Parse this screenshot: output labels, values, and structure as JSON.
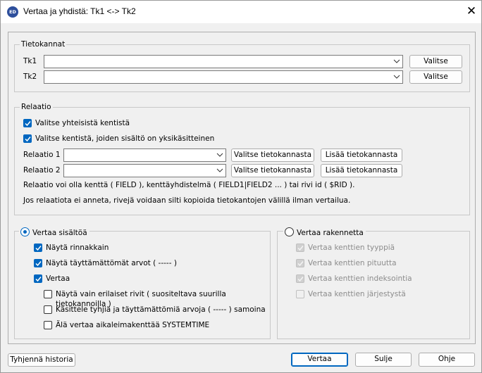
{
  "window": {
    "title": "Vertaa ja yhdistä:  Tk1 <-> Tk2",
    "app_icon": "ED"
  },
  "tietokannat": {
    "legend": "Tietokannat",
    "rows": [
      {
        "label": "Tk1",
        "value": "",
        "button": "Valitse"
      },
      {
        "label": "Tk2",
        "value": "",
        "button": "Valitse"
      }
    ]
  },
  "relaatio": {
    "legend": "Relaatio",
    "check_common": {
      "label": "Valitse yhteisistä kentistä",
      "checked": true
    },
    "check_unique": {
      "label": "Valitse kentistä, joiden sisältö on yksikäsitteinen",
      "checked": true
    },
    "rows": [
      {
        "label": "Relaatio 1",
        "value": "",
        "select_button": "Valitse tietokannasta",
        "add_button": "Lisää tietokannasta"
      },
      {
        "label": "Relaatio 2",
        "value": "",
        "select_button": "Valitse tietokannasta",
        "add_button": "Lisää tietokannasta"
      }
    ],
    "info1": "Relaatio voi olla kenttä ( FIELD ), kenttäyhdistelmä ( FIELD1|FIELD2 ... ) tai rivi id ( $RID ).",
    "info2": "Jos relaatiota ei anneta, rivejä voidaan silti kopioida tietokantojen välillä ilman vertailua."
  },
  "vertaa_sisaltoa": {
    "label": "Vertaa sisältöä",
    "selected": true,
    "options": [
      {
        "label": "Näytä rinnakkain",
        "checked": true
      },
      {
        "label": "Näytä täyttämättömät arvot ( ----- )",
        "checked": true
      },
      {
        "label": "Vertaa",
        "checked": true
      },
      {
        "label": "Näytä vain erilaiset rivit ( suositeltava suurilla tietokannoilla )",
        "checked": false
      },
      {
        "label": "Käsittele tyhjiä ja täyttämättömiä arvoja ( ----- ) samoina",
        "checked": false
      },
      {
        "label": "Älä vertaa aikaleimakenttää SYSTEMTIME",
        "checked": false
      }
    ]
  },
  "vertaa_rakennetta": {
    "label": "Vertaa rakennetta",
    "selected": false,
    "options": [
      {
        "label": "Vertaa kenttien tyyppiä",
        "checked": true
      },
      {
        "label": "Vertaa kenttien pituutta",
        "checked": true
      },
      {
        "label": "Vertaa kenttien indeksointia",
        "checked": true
      },
      {
        "label": "Vertaa kenttien järjestystä",
        "checked": false
      }
    ]
  },
  "footer": {
    "clear_history": "Tyhjennä historia",
    "compare": "Vertaa",
    "close": "Sulje",
    "help": "Ohje"
  },
  "colors": {
    "accent": "#0067c0",
    "background": "#f0f0f0"
  }
}
